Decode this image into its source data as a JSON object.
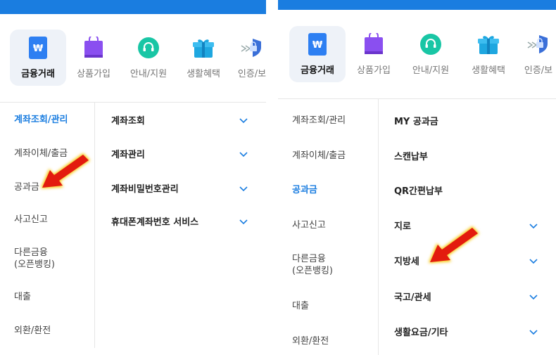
{
  "categories": [
    {
      "label": "금융거래",
      "icon": "won-card-icon",
      "active": true
    },
    {
      "label": "상품가입",
      "icon": "shopping-bag-icon",
      "active": false
    },
    {
      "label": "안내/지원",
      "icon": "headset-icon",
      "active": false
    },
    {
      "label": "생활혜택",
      "icon": "gift-icon",
      "active": false
    },
    {
      "label": "인증/보",
      "icon": "shield-lock-icon",
      "active": false
    }
  ],
  "left_panel": {
    "nav": [
      {
        "label": "계좌조회/관리",
        "active": true
      },
      {
        "label": "계좌이체/출금",
        "active": false
      },
      {
        "label": "공과금",
        "active": false
      },
      {
        "label": "사고신고",
        "active": false
      },
      {
        "label": "다른금융\n(오픈뱅킹)",
        "active": false
      },
      {
        "label": "대출",
        "active": false
      },
      {
        "label": "외환/환전",
        "active": false
      }
    ],
    "sub_items": [
      {
        "label": "계좌조회",
        "expandable": true
      },
      {
        "label": "계좌관리",
        "expandable": true
      },
      {
        "label": "계좌비밀번호관리",
        "expandable": true
      },
      {
        "label": "휴대폰계좌번호 서비스",
        "expandable": true
      }
    ]
  },
  "right_panel": {
    "nav": [
      {
        "label": "계좌조회/관리",
        "active": false
      },
      {
        "label": "계좌이체/출금",
        "active": false
      },
      {
        "label": "공과금",
        "active": true
      },
      {
        "label": "사고신고",
        "active": false
      },
      {
        "label": "다른금융\n(오픈뱅킹)",
        "active": false
      },
      {
        "label": "대출",
        "active": false
      },
      {
        "label": "외환/환전",
        "active": false
      }
    ],
    "sub_items": [
      {
        "label": "MY 공과금",
        "expandable": false
      },
      {
        "label": "스캔납부",
        "expandable": false
      },
      {
        "label": "QR간편납부",
        "expandable": false
      },
      {
        "label": "지로",
        "expandable": true
      },
      {
        "label": "지방세",
        "expandable": true
      },
      {
        "label": "국고/관세",
        "expandable": true
      },
      {
        "label": "생활요금/기타",
        "expandable": true
      }
    ]
  },
  "colors": {
    "brand": "#1a7de0",
    "arrow": "#e31b0e",
    "arrow_glow": "#f5c400"
  }
}
